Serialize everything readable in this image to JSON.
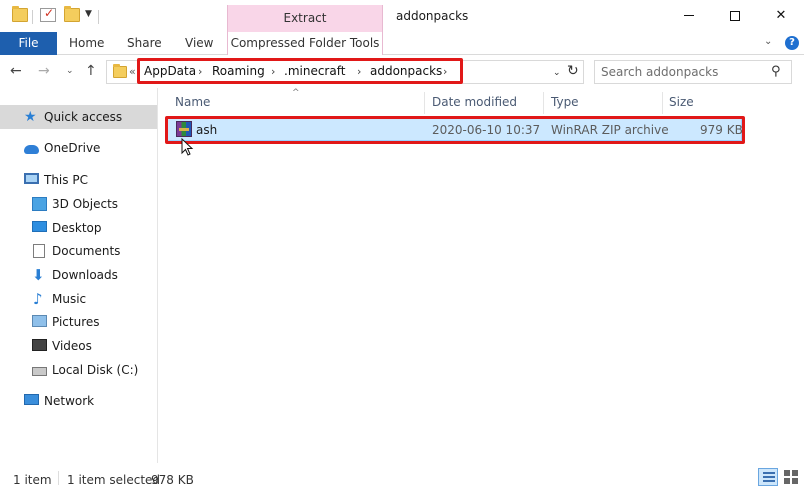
{
  "window": {
    "title": "addonpacks",
    "context_tab": "Extract",
    "controls": {
      "minimize": "—",
      "maximize": "□",
      "close": "✕"
    }
  },
  "ribbon": {
    "tabs": [
      "File",
      "Home",
      "Share",
      "View",
      "Compressed Folder Tools"
    ],
    "expand": "⌄",
    "help": "?"
  },
  "nav_buttons": {
    "back": "←",
    "forward": "→",
    "recent": "⌄",
    "up": "↑"
  },
  "address": {
    "prefix": "«",
    "crumbs": [
      "AppData",
      "Roaming",
      ".minecraft",
      "addonpacks"
    ],
    "separator": "›",
    "dropdown": "⌄",
    "refresh": "↻"
  },
  "search": {
    "placeholder": "Search addonpacks",
    "icon": "⚲"
  },
  "nav_pane": {
    "items": [
      {
        "label": "Quick access",
        "icon": "star-icon",
        "selected": true
      },
      {
        "label": "OneDrive",
        "icon": "cloud-icon"
      },
      {
        "label": "This PC",
        "icon": "computer-icon"
      },
      {
        "label": "3D Objects",
        "icon": "cube-icon"
      },
      {
        "label": "Desktop",
        "icon": "desktop-icon"
      },
      {
        "label": "Documents",
        "icon": "document-icon"
      },
      {
        "label": "Downloads",
        "icon": "download-icon"
      },
      {
        "label": "Music",
        "icon": "music-icon"
      },
      {
        "label": "Pictures",
        "icon": "pictures-icon"
      },
      {
        "label": "Videos",
        "icon": "videos-icon"
      },
      {
        "label": "Local Disk (C:)",
        "icon": "disk-icon"
      },
      {
        "label": "Network",
        "icon": "network-icon"
      }
    ],
    "glyphs": {
      "star": "★",
      "download": "⬇",
      "music": "♪"
    }
  },
  "columns": [
    "Name",
    "Date modified",
    "Type",
    "Size"
  ],
  "sort_indicator": "^",
  "files": [
    {
      "name": "ash",
      "date": "2020-06-10 10:37",
      "type": "WinRAR ZIP archive",
      "size": "979 KB",
      "icon": "winrar-archive-icon",
      "selected": true
    }
  ],
  "status": {
    "item_count": "1 item",
    "selection": "1 item selected",
    "selection_size": "978 KB"
  },
  "colors": {
    "file_tab": "#1e5fae",
    "context_tab": "#f9d6e8",
    "selection": "#cce8ff",
    "annotation_red": "#e11818",
    "quick_access_bg": "#d9d9d9"
  }
}
